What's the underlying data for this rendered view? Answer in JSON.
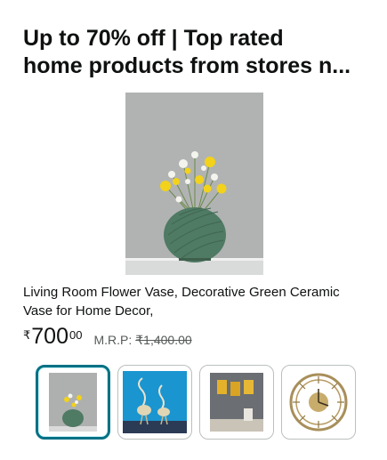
{
  "header": {
    "title_line1": "Up to 70% off | Top rated",
    "title_line2": "home products from stores n..."
  },
  "product": {
    "image_icon": "vase-with-flowers-image",
    "description_line1": "Living Room Flower Vase, Decorative Green Ceramic",
    "description_line2": "Vase for Home Decor,",
    "price": {
      "currency_symbol": "₹",
      "whole": "700",
      "fraction": "00",
      "mrp_label": "M.R.P:",
      "mrp_value": "₹1,400.00"
    }
  },
  "thumbnails": [
    {
      "icon": "vase-thumbnail",
      "selected": true
    },
    {
      "icon": "crane-figurines-thumbnail",
      "selected": false
    },
    {
      "icon": "wall-frames-thumbnail",
      "selected": false
    },
    {
      "icon": "wall-clock-thumbnail",
      "selected": false
    }
  ],
  "colors": {
    "accent_selected": "#007185",
    "text_primary": "#0f1111",
    "text_secondary": "#565959",
    "vase_green": "#4f7a63"
  }
}
